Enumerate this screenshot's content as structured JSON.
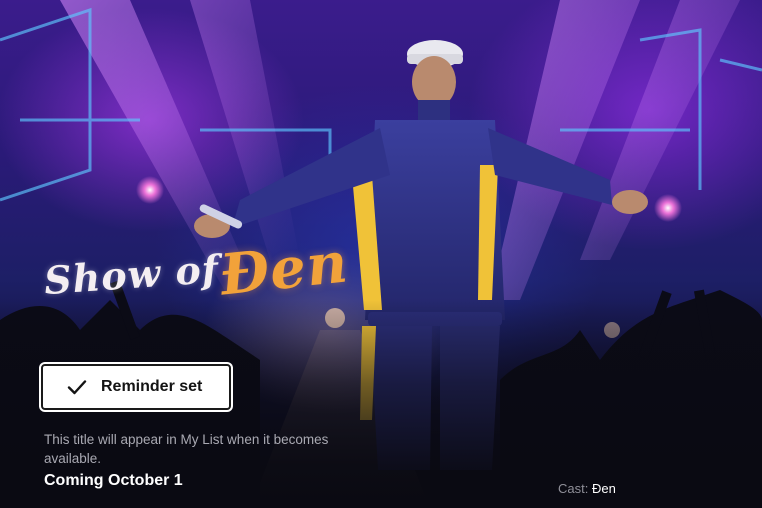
{
  "hero": {
    "title_logo": {
      "part1": "Show of",
      "part2": "Đen"
    }
  },
  "reminder_button": {
    "icon": "check-icon",
    "label": "Reminder set"
  },
  "availability_note": "This title will appear in My List when it becomes available.",
  "release": {
    "label": "Coming October 1"
  },
  "cast": {
    "label": "Cast:",
    "name": "Đen"
  },
  "colors": {
    "button_bg": "#ffffff",
    "button_text": "#141414",
    "note_text": "#a9a9b2",
    "logo_accent": "#f2a23a"
  }
}
